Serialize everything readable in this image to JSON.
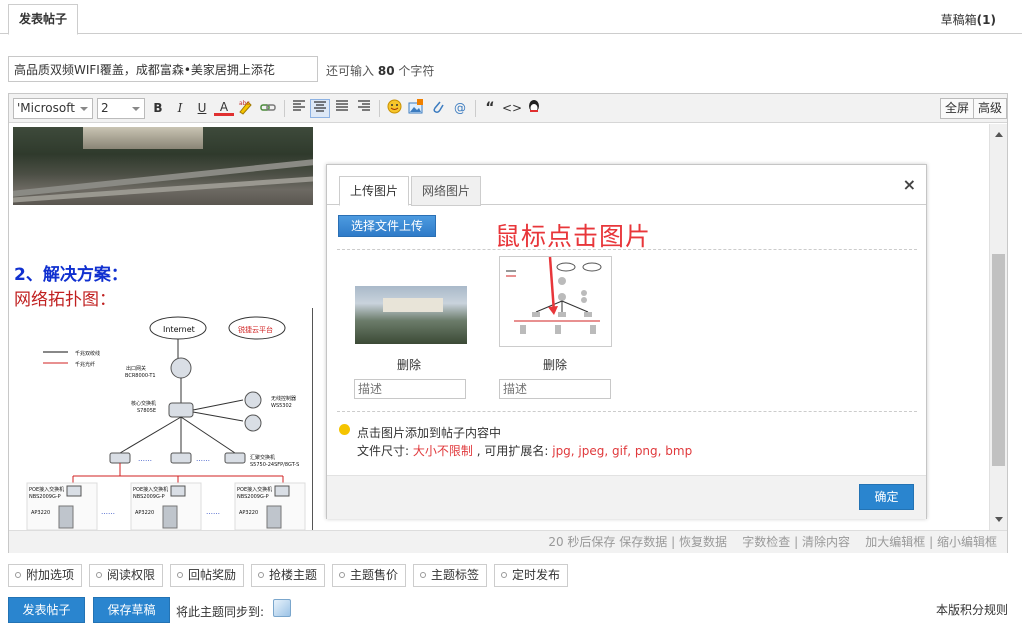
{
  "top": {
    "tab": "发表帖子",
    "drafts_label": "草稿箱",
    "drafts_count": "(1)"
  },
  "title": {
    "value": "高品质双频WIFI覆盖，成都富森•美家居拥上添花",
    "hint_pre": "还可输入",
    "hint_num": "80",
    "hint_post": "个字符"
  },
  "toolbar": {
    "font": "'Microsoft",
    "size": "2",
    "bold": "B",
    "italic": "I",
    "underline": "U",
    "color": "A",
    "quote": "“",
    "code": "<>",
    "at": "@",
    "fullscreen": "全屏",
    "advanced": "高级"
  },
  "content": {
    "solution_heading": "2、解决方案：",
    "topology_heading": "网络拓扑图：",
    "topology": {
      "internet": "Internet",
      "cloud": "锐捷云平台",
      "legend1": "千兆双绞线",
      "legend2": "千兆光纤",
      "gateway": "出口网关",
      "gateway_model": "BCR8000-T1",
      "core": "核心交换机",
      "core_model": "S7805E",
      "wlc": "无线控制器",
      "wlc_model": "WS5302",
      "agg": "汇聚交换机",
      "agg_model": "S5750-24SFP/8GT-S",
      "poe": "POE接入交换机",
      "poe_model": "NBS2009G-P",
      "ap": "AP3220",
      "dots": "……"
    }
  },
  "statusbar": {
    "autosave": "20 秒后保存",
    "save": "保存数据",
    "restore": "恢复数据",
    "wordcheck": "字数检查",
    "clear": "清除内容",
    "enlarge": "加大编辑框",
    "shrink": "缩小编辑框",
    "sep": "|"
  },
  "dialog": {
    "tab_upload": "上传图片",
    "tab_web": "网络图片",
    "close": "×",
    "upload_button": "选择文件上传",
    "annotation": "鼠标点击图片",
    "images": [
      {
        "delete": "删除",
        "desc_placeholder": "描述"
      },
      {
        "delete": "删除",
        "desc_placeholder": "描述"
      }
    ],
    "tip": "点击图片添加到帖子内容中",
    "size_label": "文件尺寸:",
    "size_value": "大小不限制",
    "ext_label": ", 可用扩展名:",
    "ext_value": "jpg, jpeg, gif, png, bmp",
    "ok": "确定"
  },
  "options": [
    "附加选项",
    "阅读权限",
    "回帖奖励",
    "抢楼主题",
    "主题售价",
    "主题标签",
    "定时发布"
  ],
  "bottom": {
    "post": "发表帖子",
    "save_draft": "保存草稿",
    "sync": "将此主题同步到:",
    "rules": "本版积分规则"
  }
}
